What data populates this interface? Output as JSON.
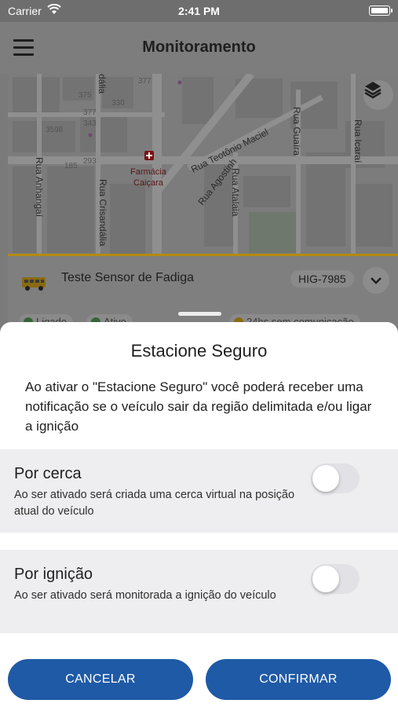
{
  "status_bar": {
    "carrier": "Carrier",
    "time": "2:41 PM"
  },
  "header": {
    "title": "Monitoramento"
  },
  "map": {
    "labels": {
      "street_agostinho": "Rua Agostinh",
      "street_teotonio": "Rua Teotônio Maciel",
      "street_guaira": "Rua Guaíra",
      "street_icarai": "Rua Icaraí",
      "street_anhangai": "Rua Anhangaí",
      "street_crisandalia": "Rua Crisandália",
      "street_atalaia": "Rua Atalaia",
      "street_partial": "dália",
      "pharmacy_line1": "Farmácia",
      "pharmacy_line2": "Caiçara",
      "num_377": "377",
      "num_375": "375",
      "num_330": "330",
      "num_3771": "377",
      "num_343": "343",
      "num_3598": "3598",
      "num_185": "185",
      "num_293": "293"
    }
  },
  "vehicle": {
    "name": "Teste Sensor de Fadiga",
    "plate": "HIG-7985",
    "chips": [
      "Ligado",
      "Ativo",
      "24hs sem comunicação"
    ]
  },
  "sheet": {
    "title": "Estacione Seguro",
    "description": "Ao ativar o \"Estacione Seguro\" você poderá receber uma notificação se o veículo sair da região delimitada e/ou ligar a ignição",
    "options": [
      {
        "title": "Por cerca",
        "description": "Ao ser ativado será criada uma cerca virtual na posição atual do veículo",
        "enabled": false
      },
      {
        "title": "Por ignição",
        "description": "Ao ser ativado será monitorada a ignição do veículo",
        "enabled": false
      }
    ],
    "cancel_label": "CANCELAR",
    "confirm_label": "CONFIRMAR"
  },
  "colors": {
    "primary": "#1f5aa6",
    "accent_divider": "#b48a10",
    "pharmacy": "#7a1010"
  }
}
